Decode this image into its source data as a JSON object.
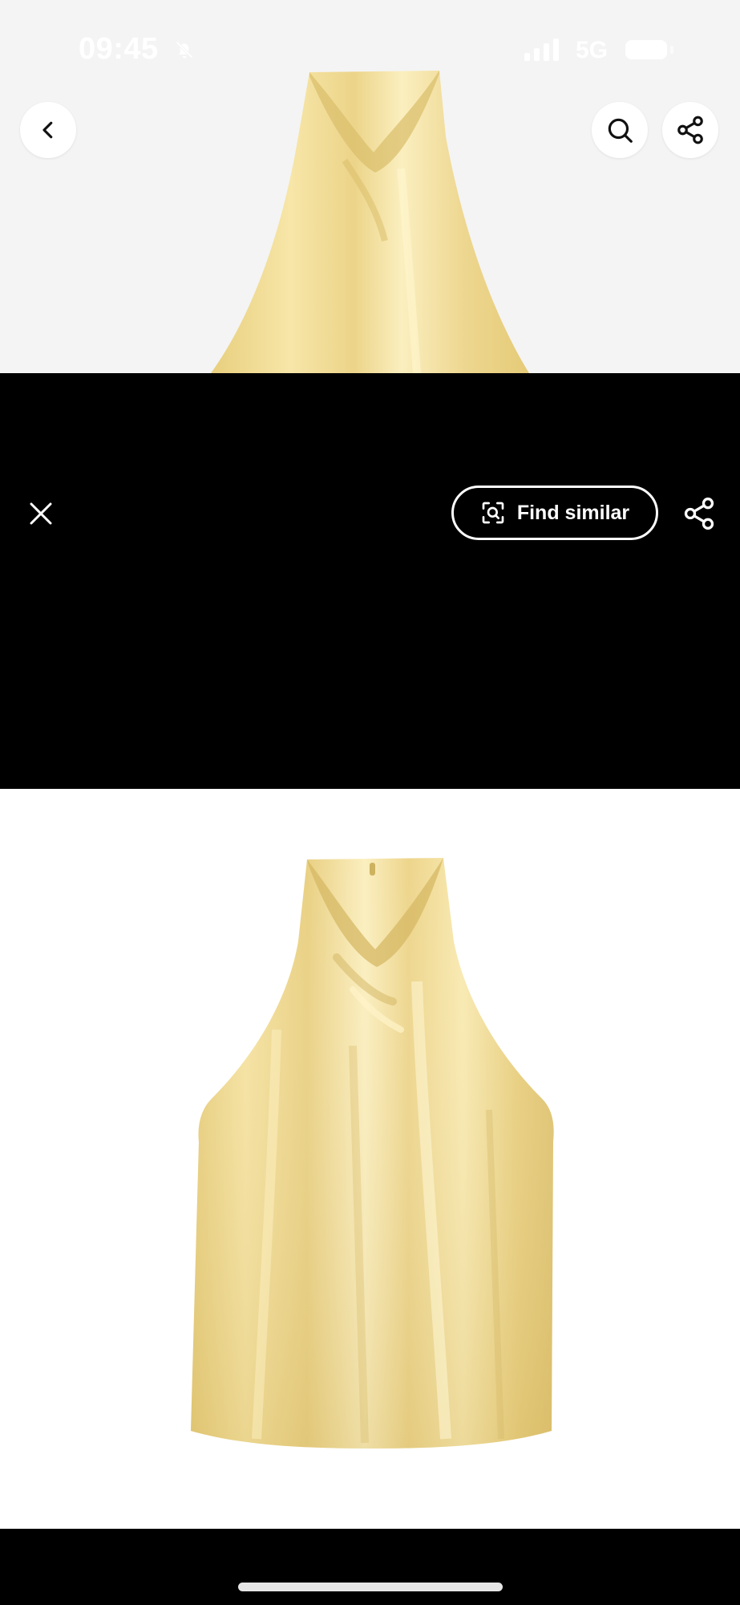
{
  "status_bar": {
    "time": "09:45",
    "network": "5G",
    "bell_icon": "bell-slash-icon",
    "signal_icon": "signal-icon",
    "battery_icon": "battery-icon"
  },
  "header": {
    "back_icon": "chevron-left-icon",
    "search_icon": "search-icon",
    "share_icon": "share-icon"
  },
  "viewer": {
    "close_icon": "close-icon",
    "find_similar_label": "Find similar",
    "find_similar_icon": "scan-search-icon",
    "share_icon": "share-icon"
  },
  "product_image": {
    "subject": "halter-top-image",
    "color": "#f2dc8f"
  },
  "colors": {
    "top_background": "#f4f4f4",
    "overlay": "#000000",
    "image_background": "#ffffff"
  }
}
